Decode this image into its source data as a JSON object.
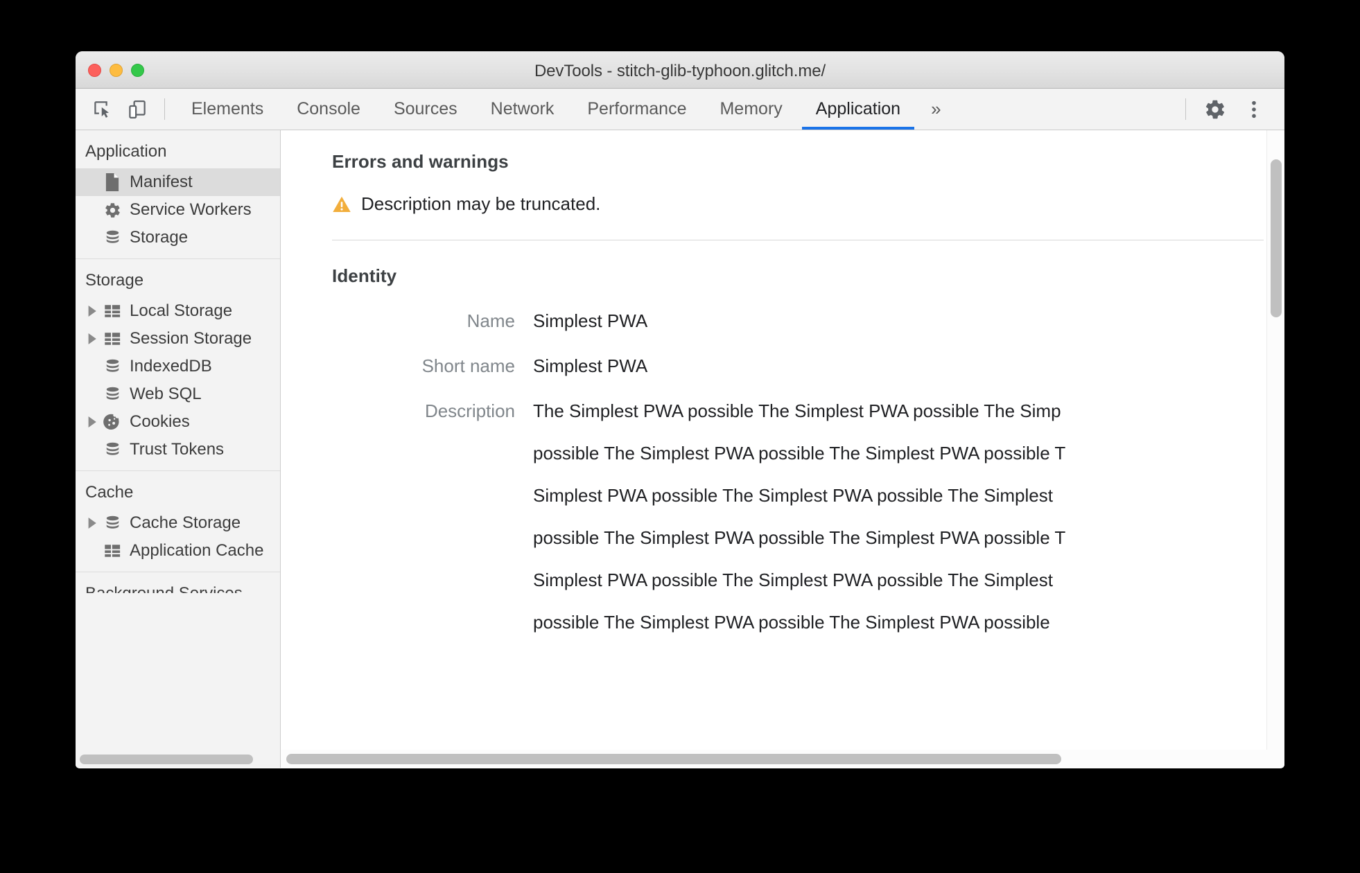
{
  "window": {
    "title": "DevTools - stitch-glib-typhoon.glitch.me/",
    "controls": {
      "close": "close",
      "minimize": "minimize",
      "zoom": "zoom"
    }
  },
  "toolbar": {
    "inspect_icon": "inspect-element-icon",
    "device_icon": "device-toolbar-icon",
    "overflow_label": "»",
    "settings_icon": "gear-icon",
    "more_icon": "kebab-menu-icon",
    "tabs": [
      {
        "label": "Elements",
        "active": false
      },
      {
        "label": "Console",
        "active": false
      },
      {
        "label": "Sources",
        "active": false
      },
      {
        "label": "Network",
        "active": false
      },
      {
        "label": "Performance",
        "active": false
      },
      {
        "label": "Memory",
        "active": false
      },
      {
        "label": "Application",
        "active": true
      }
    ],
    "active_tab": "Application",
    "accent_color": "#1a73e8"
  },
  "sidebar": {
    "sections": [
      {
        "header": "Application",
        "items": [
          {
            "label": "Manifest",
            "icon": "document-icon",
            "expandable": false,
            "selected": true
          },
          {
            "label": "Service Workers",
            "icon": "gear-icon",
            "expandable": false,
            "selected": false
          },
          {
            "label": "Storage",
            "icon": "database-icon",
            "expandable": false,
            "selected": false
          }
        ]
      },
      {
        "header": "Storage",
        "items": [
          {
            "label": "Local Storage",
            "icon": "table-icon",
            "expandable": true,
            "selected": false
          },
          {
            "label": "Session Storage",
            "icon": "table-icon",
            "expandable": true,
            "selected": false
          },
          {
            "label": "IndexedDB",
            "icon": "database-icon",
            "expandable": false,
            "selected": false
          },
          {
            "label": "Web SQL",
            "icon": "database-icon",
            "expandable": false,
            "selected": false
          },
          {
            "label": "Cookies",
            "icon": "cookie-icon",
            "expandable": true,
            "selected": false
          },
          {
            "label": "Trust Tokens",
            "icon": "database-icon",
            "expandable": false,
            "selected": false
          }
        ]
      },
      {
        "header": "Cache",
        "items": [
          {
            "label": "Cache Storage",
            "icon": "database-icon",
            "expandable": true,
            "selected": false
          },
          {
            "label": "Application Cache",
            "icon": "table-icon",
            "expandable": false,
            "selected": false
          }
        ]
      }
    ],
    "clipped_header": "Background Services"
  },
  "main": {
    "errors": {
      "title": "Errors and warnings",
      "warning_icon": "warning-triangle-icon",
      "warning_color": "#f2ae3c",
      "message": "Description may be truncated."
    },
    "identity": {
      "title": "Identity",
      "fields": [
        {
          "key": "Name",
          "value": "Simplest PWA"
        },
        {
          "key": "Short name",
          "value": "Simplest PWA"
        }
      ],
      "description_key": "Description",
      "description_lines": [
        "The Simplest PWA possible The Simplest PWA possible The Simp",
        "possible The Simplest PWA possible The Simplest PWA possible T",
        "Simplest PWA possible The Simplest PWA possible The Simplest",
        "possible The Simplest PWA possible The Simplest PWA possible T",
        "Simplest PWA possible The Simplest PWA possible The Simplest",
        "possible The Simplest PWA possible The Simplest PWA possible"
      ]
    }
  },
  "scrollbars": {
    "sidebar_horizontal": "sidebar-horizontal-scrollbar",
    "main_vertical": "main-vertical-scrollbar",
    "main_horizontal": "main-horizontal-scrollbar"
  }
}
